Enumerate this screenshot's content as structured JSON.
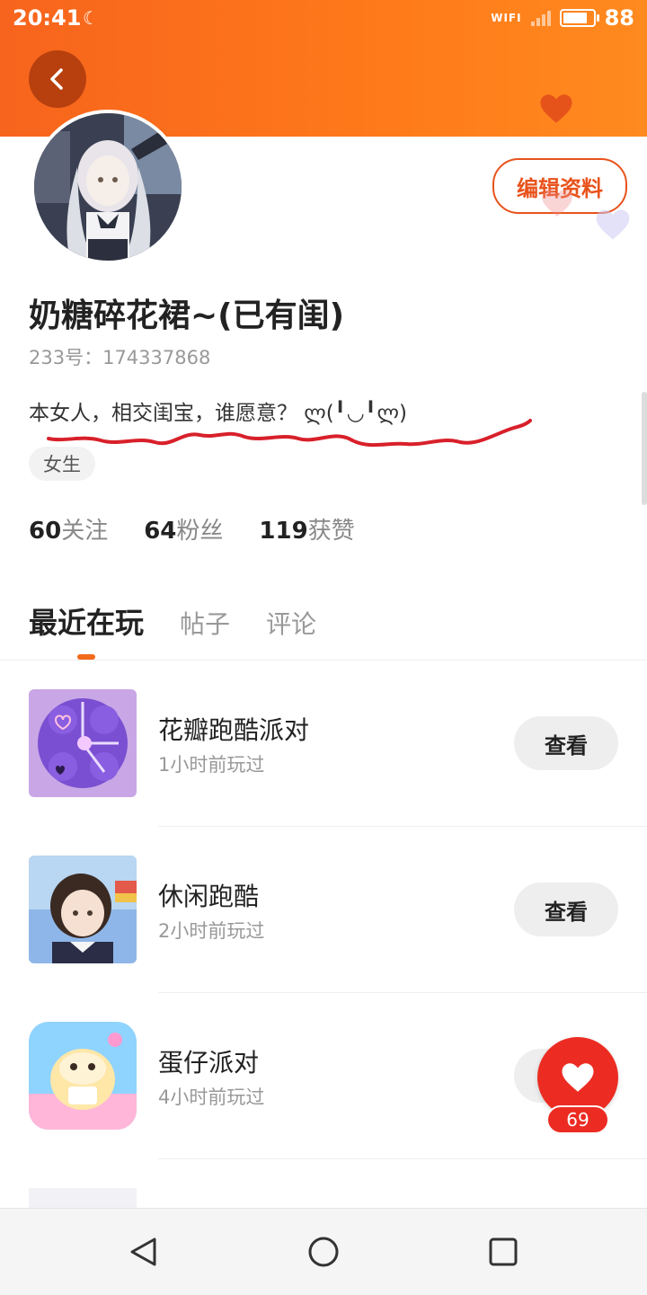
{
  "status_bar": {
    "time": "20:41",
    "wifi_label": "WIFI",
    "battery": "88",
    "battery_level": 0.88
  },
  "header": {
    "accent": "#f7641d"
  },
  "profile": {
    "edit_label": "编辑资料",
    "username": "奶糖碎花裙~(已有闺)",
    "uid": "233号：174337868",
    "bio": "本女人，相交闺宝，谁愿意？ ლ(╹◡╹ლ)",
    "tag": "女生",
    "stats": [
      {
        "num": "60",
        "label": "关注"
      },
      {
        "num": "64",
        "label": "粉丝"
      },
      {
        "num": "119",
        "label": "获赞"
      }
    ]
  },
  "tabs": [
    {
      "label": "最近在玩",
      "active": true
    },
    {
      "label": "帖子",
      "active": false
    },
    {
      "label": "评论",
      "active": false
    }
  ],
  "games": [
    {
      "name": "花瓣跑酷派对",
      "time": "1小时前玩过",
      "button": "查看"
    },
    {
      "name": "休闲跑酷",
      "time": "2小时前玩过",
      "button": "查看"
    },
    {
      "name": "蛋仔派对",
      "time": "4小时前玩过",
      "button": "查看"
    }
  ],
  "like": {
    "count": "69",
    "color": "#ec2c22"
  },
  "icons": [
    "back-arrow-icon",
    "heart-icon",
    "moon-icon",
    "signal-icon",
    "battery-icon",
    "nav-back-icon",
    "nav-home-icon",
    "nav-recents-icon"
  ]
}
